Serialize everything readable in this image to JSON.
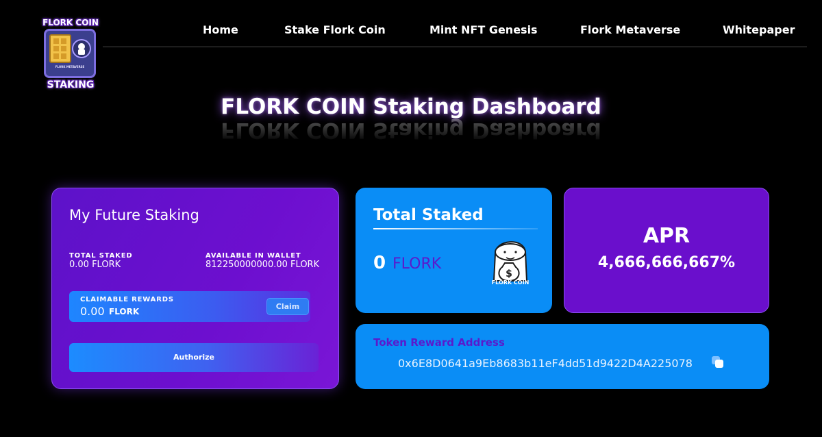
{
  "logo": {
    "top_text": "FLORK COIN",
    "bottom_text": "STAKING",
    "inner_text": "FLORK METAVERSE"
  },
  "nav": {
    "items": [
      "Home",
      "Stake Flork Coin",
      "Mint NFT Genesis",
      "Flork Metaverse",
      "Whitepaper"
    ]
  },
  "page": {
    "title": "FLORK COIN Staking Dashboard"
  },
  "staking": {
    "title": "My Future Staking",
    "total_staked_label": "TOTAL STAKED",
    "total_staked_value": "0.00 FLORK",
    "available_label": "AVAILABLE IN WALLET",
    "available_value": "812250000000.00 FLORK",
    "rewards_label": "CLAIMABLE REWARDS",
    "rewards_value": "0.00",
    "rewards_unit": "FLORK",
    "claim_label": "Claim",
    "authorize_label": "Authorize"
  },
  "total": {
    "title": "Total Staked",
    "amount": "0",
    "unit": "FLORK",
    "mascot_caption": "FLORK COIN"
  },
  "apr": {
    "label": "APR",
    "value": "4,666,666,667%"
  },
  "token": {
    "label": "Token Reward Address",
    "address": "0x6E8D0641a9Eb8683b11eF4dd51d9422D4A225078"
  },
  "colors": {
    "purple": "#6a0fcc",
    "blue": "#0a8df6",
    "accent_text": "#5a1acc"
  },
  "icons": {
    "copy": "copy-icon",
    "money_bag": "money-bag-icon"
  }
}
